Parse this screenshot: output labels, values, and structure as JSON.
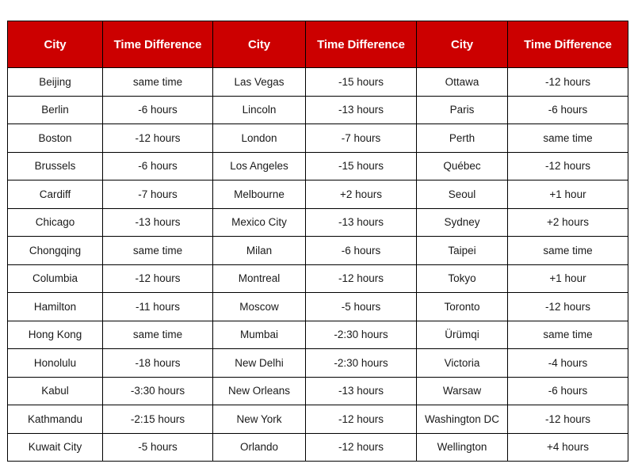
{
  "table": {
    "headers": [
      {
        "label": "City"
      },
      {
        "label": "Time Difference"
      },
      {
        "label": "City"
      },
      {
        "label": "Time Difference"
      },
      {
        "label": "City"
      },
      {
        "label": "Time Difference"
      }
    ],
    "header_bg_color": "#CC0000",
    "header_text_color": "#FFFFFF",
    "border_color": "#000000",
    "cell_bg_color": "#FFFFFF",
    "rows": [
      {
        "city_a": "Beijing",
        "diff_a": "same time",
        "city_b": "Las Vegas",
        "diff_b": "-15 hours",
        "city_c": "Ottawa",
        "diff_c": "-12 hours"
      },
      {
        "city_a": "Berlin",
        "diff_a": "-6 hours",
        "city_b": "Lincoln",
        "diff_b": "-13 hours",
        "city_c": "Paris",
        "diff_c": "-6 hours"
      },
      {
        "city_a": "Boston",
        "diff_a": "-12 hours",
        "city_b": "London",
        "diff_b": "-7 hours",
        "city_c": "Perth",
        "diff_c": "same time"
      },
      {
        "city_a": "Brussels",
        "diff_a": "-6 hours",
        "city_b": "Los Angeles",
        "diff_b": "-15 hours",
        "city_c": "Québec",
        "diff_c": "-12 hours"
      },
      {
        "city_a": "Cardiff",
        "diff_a": "-7 hours",
        "city_b": "Melbourne",
        "diff_b": "+2 hours",
        "city_c": "Seoul",
        "diff_c": "+1 hour"
      },
      {
        "city_a": "Chicago",
        "diff_a": "-13 hours",
        "city_b": "Mexico City",
        "diff_b": "-13 hours",
        "city_c": "Sydney",
        "diff_c": "+2 hours"
      },
      {
        "city_a": "Chongqing",
        "diff_a": "same time",
        "city_b": "Milan",
        "diff_b": "-6 hours",
        "city_c": "Taipei",
        "diff_c": "same time"
      },
      {
        "city_a": "Columbia",
        "diff_a": "-12 hours",
        "city_b": "Montreal",
        "diff_b": "-12 hours",
        "city_c": "Tokyo",
        "diff_c": "+1 hour"
      },
      {
        "city_a": "Hamilton",
        "diff_a": "-11 hours",
        "city_b": "Moscow",
        "diff_b": "-5 hours",
        "city_c": "Toronto",
        "diff_c": "-12 hours"
      },
      {
        "city_a": "Hong Kong",
        "diff_a": "same time",
        "city_b": "Mumbai",
        "diff_b": "-2:30 hours",
        "city_c": "Ürümqi",
        "diff_c": "same time"
      },
      {
        "city_a": "Honolulu",
        "diff_a": "-18 hours",
        "city_b": "New Delhi",
        "diff_b": "-2:30 hours",
        "city_c": "Victoria",
        "diff_c": "-4 hours"
      },
      {
        "city_a": "Kabul",
        "diff_a": "-3:30 hours",
        "city_b": "New Orleans",
        "diff_b": "-13 hours",
        "city_c": "Warsaw",
        "diff_c": "-6 hours"
      },
      {
        "city_a": "Kathmandu",
        "diff_a": "-2:15 hours",
        "city_b": "New York",
        "diff_b": "-12 hours",
        "city_c": "Washington DC",
        "diff_c": "-12 hours"
      },
      {
        "city_a": "Kuwait City",
        "diff_a": "-5 hours",
        "city_b": "Orlando",
        "diff_b": "-12 hours",
        "city_c": "Wellington",
        "diff_c": "+4 hours"
      }
    ]
  }
}
